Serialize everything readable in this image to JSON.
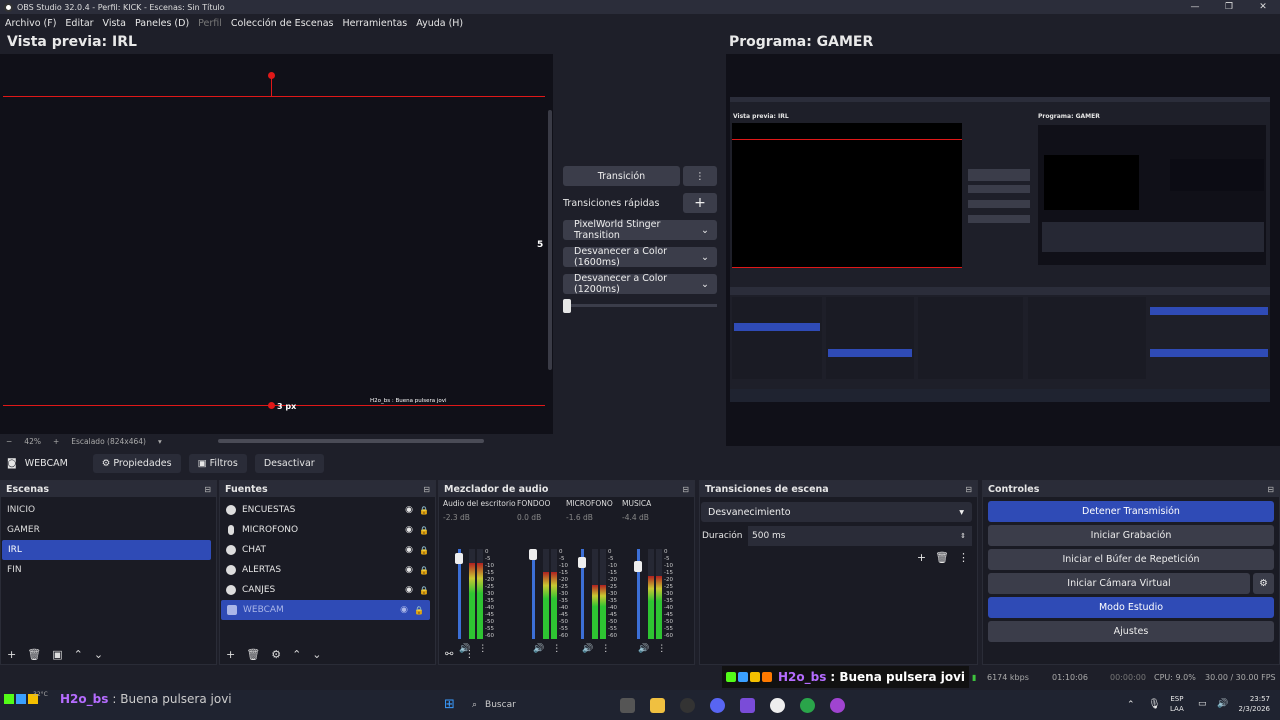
{
  "titlebar": {
    "title": "OBS Studio 32.0.4 - Perfil: KICK - Escenas: Sin Título"
  },
  "menu": [
    "Archivo (F)",
    "Editar",
    "Vista",
    "Paneles (D)",
    "Perfil",
    "Colección de Escenas",
    "Herramientas",
    "Ayuda (H)"
  ],
  "preview": {
    "title": "Vista previa: IRL",
    "measure_right": "5",
    "measure_bottom": "3 px",
    "zoom": "42%",
    "scaled": "Escalado (824x464)",
    "chat_line": "H2o_bs : Buena pulsera jovi"
  },
  "program": {
    "title": "Programa: GAMER",
    "inner_preview": "Vista previa: IRL",
    "inner_program": "Programa: GAMER"
  },
  "transition": {
    "button": "Transición",
    "quick_label": "Transiciones rápidas",
    "items": [
      "PixelWorld Stinger Transition",
      "Desvanecer a Color (1600ms)",
      "Desvanecer a Color (1200ms)"
    ],
    "slider_level": 0.0
  },
  "sourcebar": {
    "name": "WEBCAM",
    "props": "Propiedades",
    "filters": "Filtros",
    "deactivate": "Desactivar"
  },
  "scenes": {
    "title": "Escenas",
    "items": [
      "INICIO",
      "GAMER",
      "IRL",
      "FIN"
    ],
    "selected": "IRL"
  },
  "sources": {
    "title": "Fuentes",
    "items": [
      "ENCUESTAS",
      "MICROFONO",
      "CHAT",
      "ALERTAS",
      "CANJES",
      "WEBCAM"
    ],
    "selected": "WEBCAM"
  },
  "mixer": {
    "title": "Mezclador de audio",
    "channels": [
      {
        "name": "Audio del escritorio",
        "db": "-2.3 dB",
        "level": 0.85,
        "fader": 0.95
      },
      {
        "name": "FONDOO",
        "db": "0.0 dB",
        "level": 0.75,
        "fader": 1.0
      },
      {
        "name": "MICROFONO",
        "db": "-1.6 dB",
        "level": 0.6,
        "fader": 0.9
      },
      {
        "name": "MUSICA",
        "db": "-4.4 dB",
        "level": 0.7,
        "fader": 0.85
      }
    ],
    "ticks": [
      "0",
      "-5",
      "-10",
      "-15",
      "-20",
      "-25",
      "-30",
      "-35",
      "-40",
      "-45",
      "-50",
      "-55",
      "-60"
    ]
  },
  "scene_transitions": {
    "title": "Transiciones de escena",
    "selected": "Desvanecimiento",
    "duration_label": "Duración",
    "duration_value": "500 ms"
  },
  "controls": {
    "title": "Controles",
    "stop_stream": "Detener Transmisión",
    "start_record": "Iniciar Grabación",
    "replay_buffer": "Iniciar el Búfer de Repetición",
    "virtual_cam": "Iniciar Cámara Virtual",
    "studio_mode": "Modo Estudio",
    "settings": "Ajustes"
  },
  "status": {
    "chat_user": "H2o_bs",
    "chat_msg": ": Buena pulsera jovi",
    "kbps": "6174 kbps",
    "time1": "01:10:06",
    "time2": "00:00:00",
    "cpu": "CPU: 9.0%",
    "fps": "30.00 / 30.00 FPS"
  },
  "taskbar": {
    "search": "Buscar",
    "lang1": "ESP",
    "lang2": "LAA",
    "time": "23:57",
    "date": "2/3/2026",
    "weather": "32°C"
  },
  "colors": {
    "accent": "#2f4bb6",
    "red_guide": "#e01818",
    "meter_green": "#2ec432",
    "meter_yellow": "#c8c832",
    "meter_red": "#b02020"
  }
}
